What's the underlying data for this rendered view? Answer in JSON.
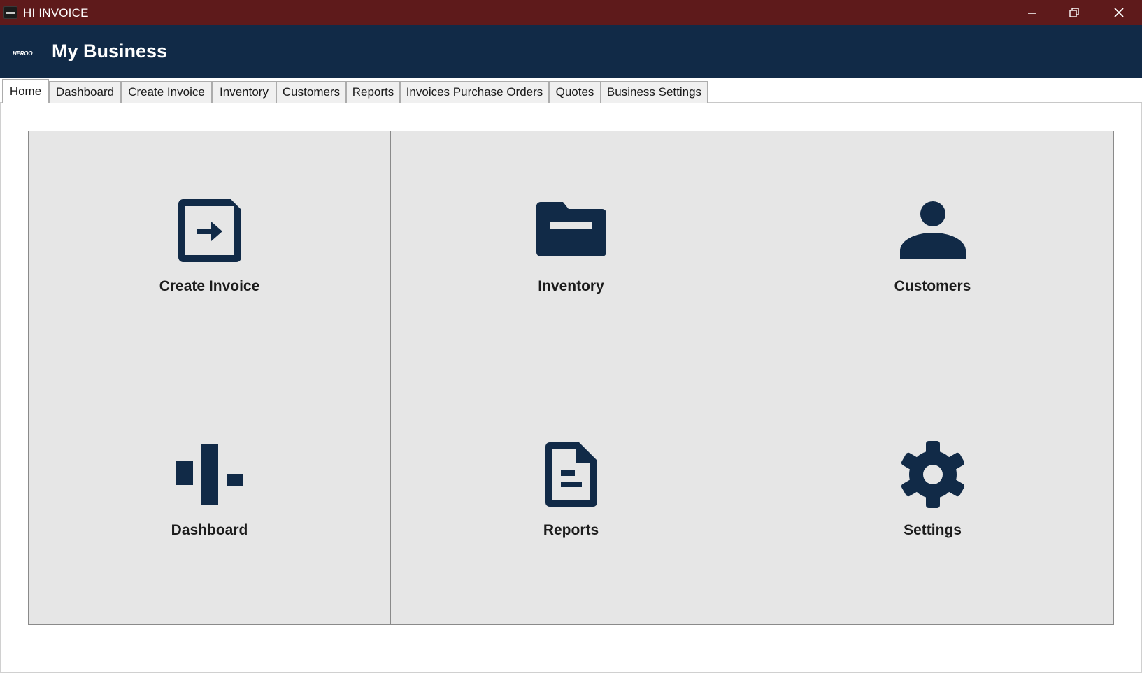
{
  "window": {
    "title": "HI INVOICE",
    "controls": {
      "minimize": "minimize-icon",
      "restore": "restore-icon",
      "close": "close-icon"
    }
  },
  "header": {
    "logo_text": "HEROO",
    "business_name": "My Business"
  },
  "tabs": [
    {
      "label": "Home",
      "active": true
    },
    {
      "label": "Dashboard",
      "active": false
    },
    {
      "label": "Create Invoice",
      "active": false
    },
    {
      "label": "Inventory",
      "active": false
    },
    {
      "label": "Customers",
      "active": false
    },
    {
      "label": "Reports",
      "active": false
    },
    {
      "label": "Invoices Purchase Orders",
      "active": false
    },
    {
      "label": "Quotes",
      "active": false
    },
    {
      "label": "Business Settings",
      "active": false
    }
  ],
  "tiles": [
    {
      "label": "Create Invoice",
      "icon": "create-invoice-icon"
    },
    {
      "label": "Inventory",
      "icon": "folder-icon"
    },
    {
      "label": "Customers",
      "icon": "person-icon"
    },
    {
      "label": "Dashboard",
      "icon": "dashboard-icon"
    },
    {
      "label": "Reports",
      "icon": "document-icon"
    },
    {
      "label": "Settings",
      "icon": "gear-icon"
    }
  ],
  "colors": {
    "titlebar": "#5e1a1b",
    "header": "#112a47",
    "icon": "#112a47",
    "tile_background": "#e6e6e6"
  }
}
